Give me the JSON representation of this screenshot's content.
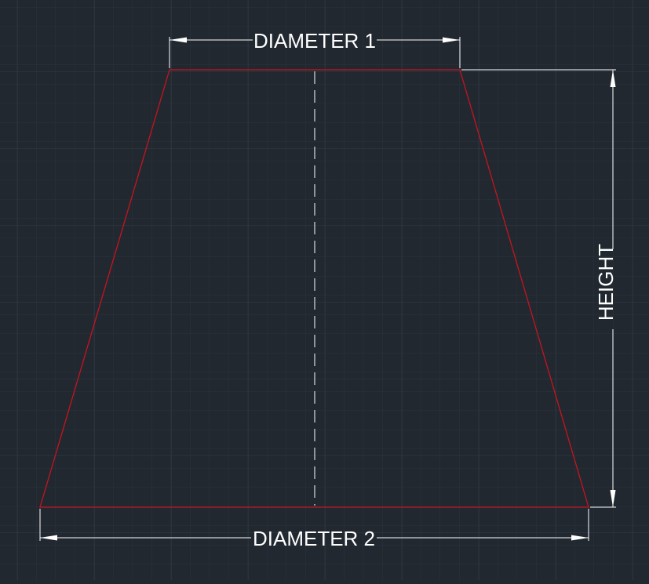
{
  "drawing": {
    "background_color": "#212830",
    "grid_minor_color": "#2a323c",
    "grid_major_color": "#333c48",
    "outline_color": "#c8141e",
    "dimension_color": "#ffffff",
    "centerline_color": "#dcdcdc"
  },
  "dimensions": {
    "top_diameter_label": "DIAMETER 1",
    "bottom_diameter_label": "DIAMETER 2",
    "height_label": "HEIGHT"
  }
}
